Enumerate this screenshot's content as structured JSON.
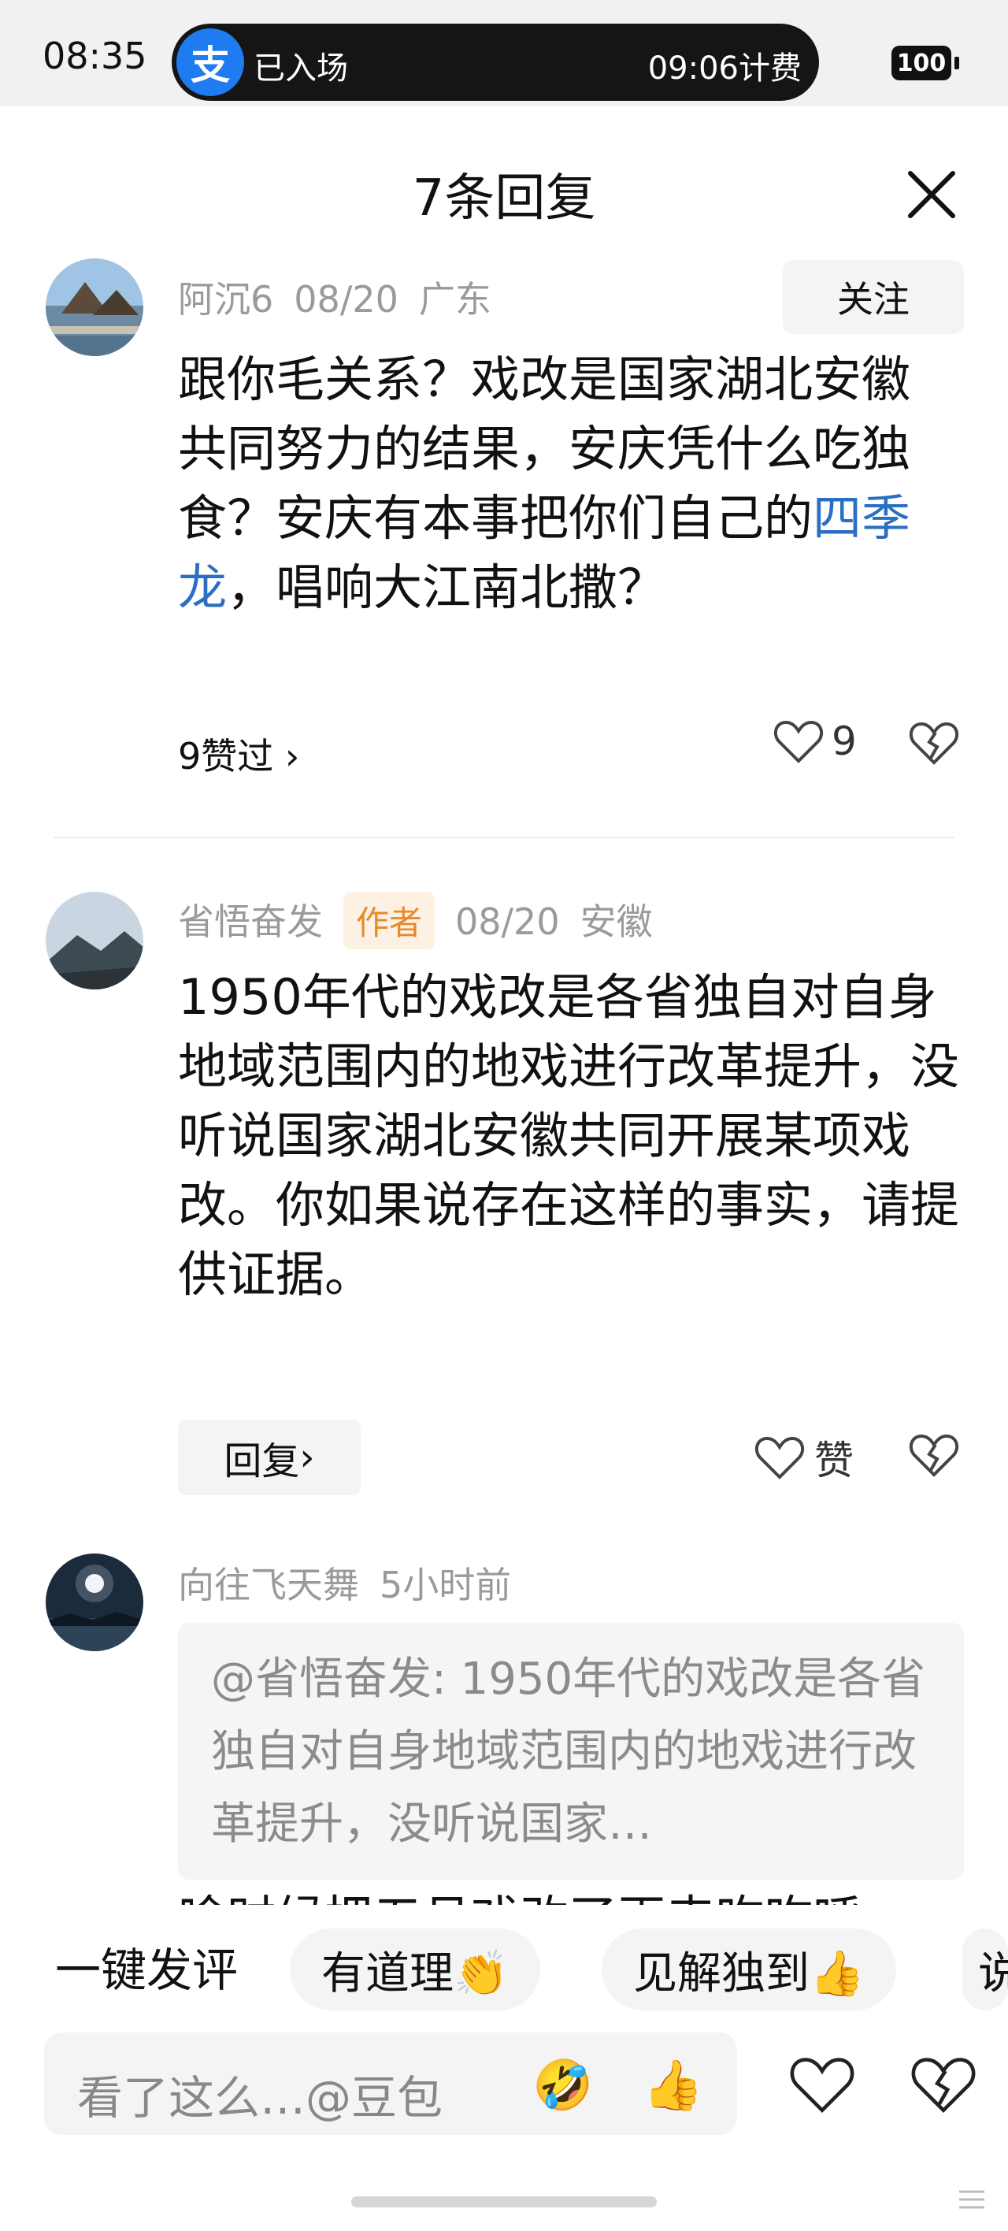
{
  "status_bar": {
    "time": "08:35",
    "pay_icon_char": "支",
    "parking_status": "已入场",
    "billing_time": "09:06计费",
    "battery": "100"
  },
  "header": {
    "title": "7条回复"
  },
  "comments": [
    {
      "username": "阿沉6",
      "date": "08/20",
      "location": "广东",
      "follow_label": "关注",
      "text_before_link": "跟你毛关系？戏改是国家湖北安徽共同努力的结果，安庆凭什么吃独食？安庆有本事把你们自己的",
      "link_text": "四季龙",
      "text_after_link": "，唱响大江南北撒？",
      "likes_summary": "9赞过",
      "like_count": "9"
    },
    {
      "username": "省悟奋发",
      "author_badge": "作者",
      "date": "08/20",
      "location": "安徽",
      "text": "1950年代的戏改是各省独自对自身地域范围内的地戏进行改革提升，没听说国家湖北安徽共同开展某项戏改。你如果说存在这样的事实，请提供证据。",
      "reply_label": "回复",
      "like_label": "赞"
    },
    {
      "username": "向往飞天舞",
      "time_ago": "5小时前",
      "quote": "@省悟奋发: 1950年代的戏改是各省独自对自身地域范围内的地戏进行改革提升，没听说国家…",
      "cut_text": "啥时候把五月戏改了再来咋咋呼"
    }
  ],
  "quick_comment": {
    "label": "一键发评",
    "chips": [
      "有道理👏",
      "见解独到👍",
      "说"
    ]
  },
  "input": {
    "placeholder": "看了这么…@豆包",
    "emoji_1": "🤣",
    "emoji_2": "👍"
  },
  "colors": {
    "link": "#2a6fc4",
    "author_badge_bg": "#fdf1e3",
    "author_badge_text": "#e8892a",
    "pay_blue": "#1f7cf0"
  }
}
